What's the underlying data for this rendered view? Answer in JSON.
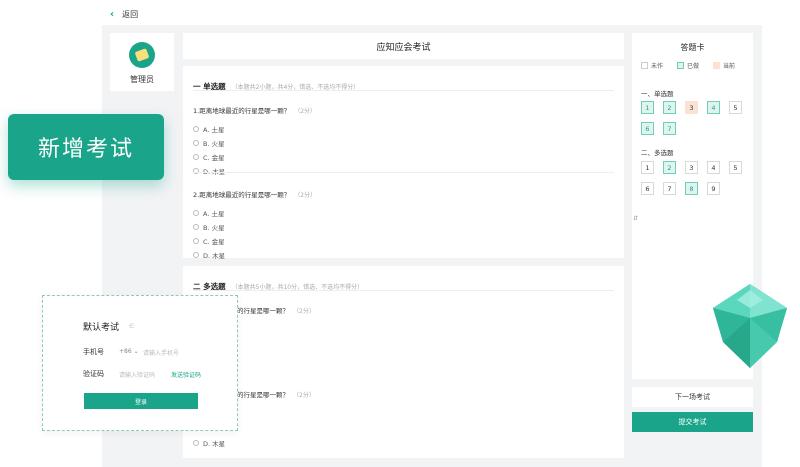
{
  "topbar": {
    "back_label": "返回"
  },
  "sidebar": {
    "user_label": "管理员"
  },
  "exam": {
    "title": "应知应会考试"
  },
  "section_single": {
    "title": "一 单选题",
    "note": "（本题共2小题，共4分，错选、不选均不得分）",
    "questions": [
      {
        "text": "1.距离地球最近的行星是哪一颗？",
        "score": "（2分）",
        "options": [
          "A. 土星",
          "B. 火星",
          "C. 金星",
          "D. 木星"
        ]
      },
      {
        "text": "2.距离地球最近的行星是哪一颗？",
        "score": "（2分）",
        "options": [
          "A. 土星",
          "B. 火星",
          "C. 金星",
          "D. 木星"
        ]
      }
    ]
  },
  "section_multi": {
    "title": "二 多选题",
    "note": "（本题共5小题，共10分，错选、不选均不得分）",
    "q1_text": "的行星是哪一颗？",
    "q1_score": "（2分）",
    "q2_text": "的行星是哪一颗？",
    "q2_score": "（2分）",
    "last_option": "D. 木星"
  },
  "answer_card": {
    "title": "答题卡",
    "legend": {
      "unanswered": "未作",
      "done": "已做",
      "current": "当前"
    },
    "single_label": "一、单选题",
    "multi_label": "二、多选题",
    "single_cells": [
      {
        "n": "1",
        "s": "done"
      },
      {
        "n": "2",
        "s": "done"
      },
      {
        "n": "3",
        "s": "cur"
      },
      {
        "n": "4",
        "s": "done"
      },
      {
        "n": "5",
        "s": "none"
      },
      {
        "n": "6",
        "s": "done"
      },
      {
        "n": "7",
        "s": "done"
      }
    ],
    "multi_cells": [
      {
        "n": "1",
        "s": "none"
      },
      {
        "n": "2",
        "s": "done"
      },
      {
        "n": "3",
        "s": "none"
      },
      {
        "n": "4",
        "s": "none"
      },
      {
        "n": "5",
        "s": "none"
      },
      {
        "n": "6",
        "s": "none"
      },
      {
        "n": "7",
        "s": "none"
      },
      {
        "n": "8",
        "s": "done"
      },
      {
        "n": "9",
        "s": "none"
      }
    ],
    "next_label": "下一场考试",
    "submit_label": "提交考试"
  },
  "new_exam_badge": "新增考试",
  "login": {
    "title": "默认考试",
    "title_mark": "∈",
    "phone_label": "手机号",
    "country_code": "+86 ⌄",
    "phone_placeholder": "请输入手机号",
    "code_label": "验证码",
    "code_placeholder": "请输入验证码",
    "get_code": "发送验证码",
    "submit": "登录"
  },
  "scroll_mark": "⇵",
  "colors": {
    "accent": "#1aa58a",
    "gem": "#4fd1b6"
  }
}
